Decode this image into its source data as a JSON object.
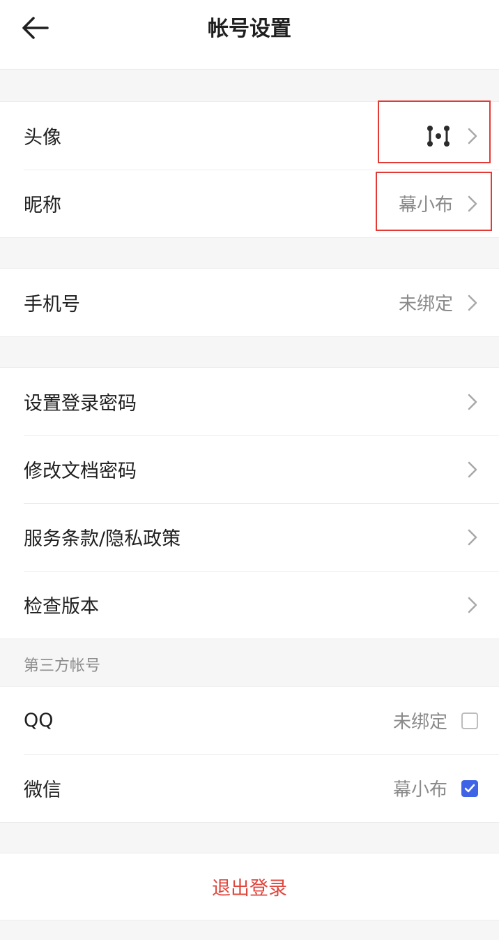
{
  "header": {
    "title": "帐号设置",
    "back_icon": "arrow-left-icon"
  },
  "profile": {
    "avatar_label": "头像",
    "avatar_icon": "logo-icon",
    "nickname_label": "昵称",
    "nickname_value": "幕小布"
  },
  "phone": {
    "label": "手机号",
    "value": "未绑定"
  },
  "settings": {
    "items": [
      {
        "label": "设置登录密码"
      },
      {
        "label": "修改文档密码"
      },
      {
        "label": "服务条款/隐私政策"
      },
      {
        "label": "检查版本"
      }
    ]
  },
  "third_party": {
    "section_label": "第三方帐号",
    "qq": {
      "label": "QQ",
      "value": "未绑定",
      "checked": false
    },
    "wechat": {
      "label": "微信",
      "value": "幕小布",
      "checked": true
    }
  },
  "logout": {
    "label": "退出登录"
  },
  "colors": {
    "accent": "#3f63e6",
    "danger": "#e0463c",
    "highlight": "#e53935"
  }
}
